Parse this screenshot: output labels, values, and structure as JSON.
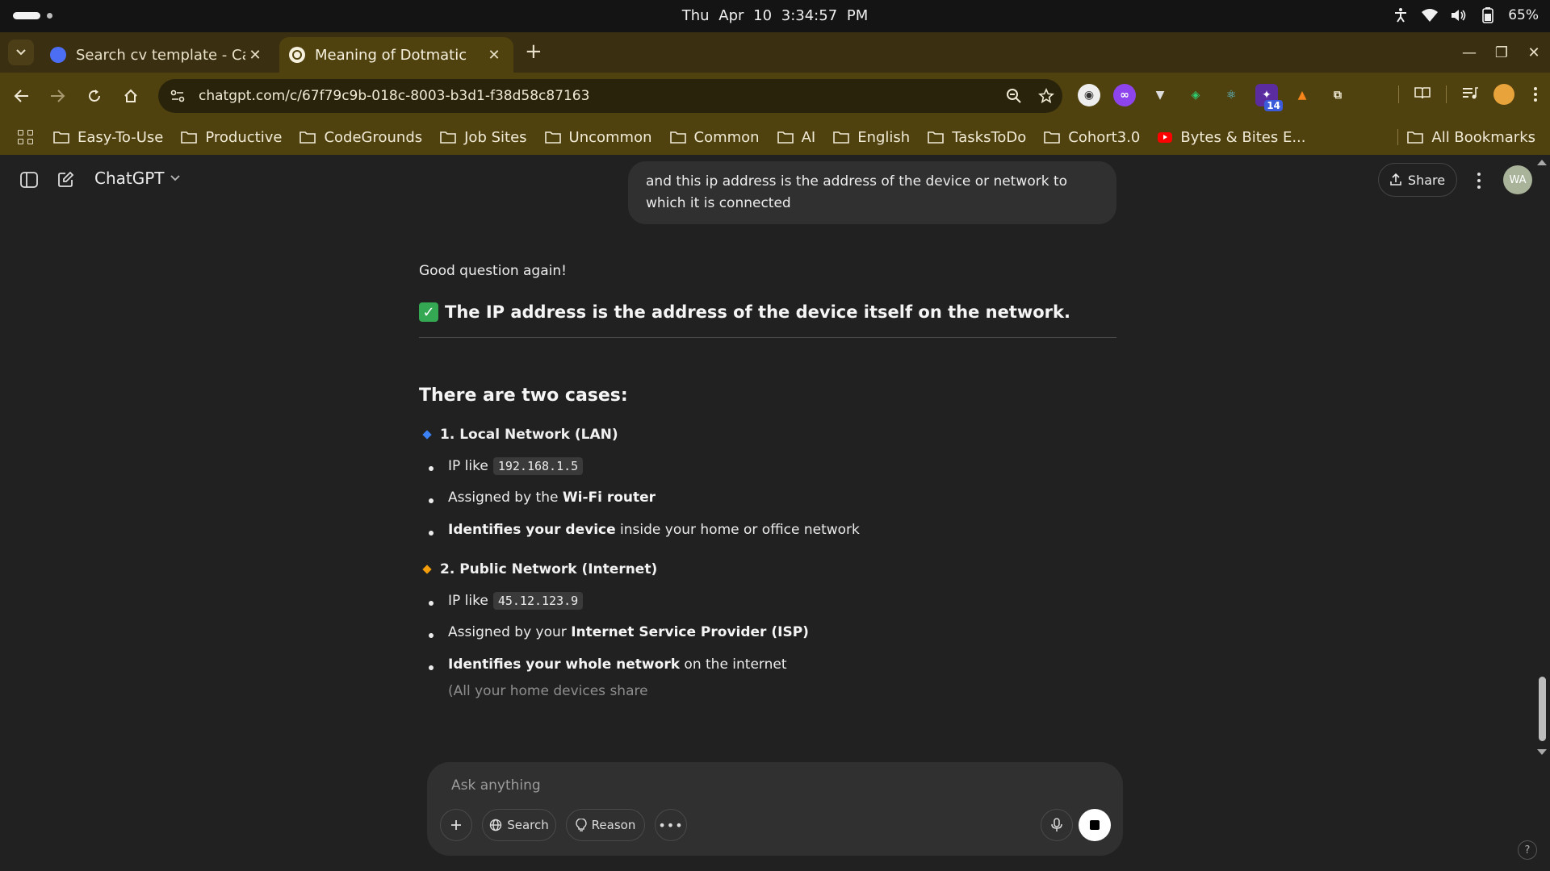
{
  "os": {
    "date": "Thu Apr 10",
    "time": "3:34:57 PM",
    "battery": "65%"
  },
  "browser": {
    "tabs": [
      {
        "title": "Search cv template - Can",
        "favicon_color": "#4c6ef5"
      },
      {
        "title": "Meaning of Dotmatic",
        "favicon_color": "#ffffff",
        "active": true
      }
    ],
    "url": "chatgpt.com/c/67f79c9b-018c-8003-b3d1-f38d58c87163",
    "extension_badge": "14",
    "bookmarks": [
      "Easy-To-Use",
      "Productive",
      "CodeGrounds",
      "Job Sites",
      "Uncommon",
      "Common",
      "AI",
      "English",
      "TasksToDo",
      "Cohort3.0",
      "Bytes & Bites E..."
    ],
    "all_bookmarks": "All Bookmarks",
    "theme": {
      "tabstrip": "#3a2f10",
      "toolbar": "#50420f"
    }
  },
  "chat": {
    "app_title": "ChatGPT",
    "share_label": "Share",
    "avatar_initials": "WA",
    "user_message": "and this ip address is the address of the device or network to which it is connected",
    "answer": {
      "intro": "Good question again!",
      "headline": "The IP address is the address of the device itself on the network.",
      "subheading": "There are two cases:",
      "case1_title": "1. Local Network (LAN)",
      "case1_b1_prefix": "IP like",
      "case1_b1_code": "192.168.1.5",
      "case1_b2_prefix": "Assigned by the",
      "case1_b2_bold": "Wi-Fi router",
      "case1_b3_bold": "Identifies your device",
      "case1_b3_suffix": "inside your home or office network",
      "case2_title": "2. Public Network (Internet)",
      "case2_b1_prefix": "IP like",
      "case2_b1_code": "45.12.123.9",
      "case2_b2_prefix": "Assigned by your",
      "case2_b2_bold": "Internet Service Provider (ISP)",
      "case2_b3_bold": "Identifies your whole network",
      "case2_b3_suffix": "on the internet",
      "streaming_text": "(All your home devices share"
    },
    "composer": {
      "placeholder": "Ask anything",
      "search_label": "Search",
      "reason_label": "Reason"
    },
    "help": "?"
  }
}
